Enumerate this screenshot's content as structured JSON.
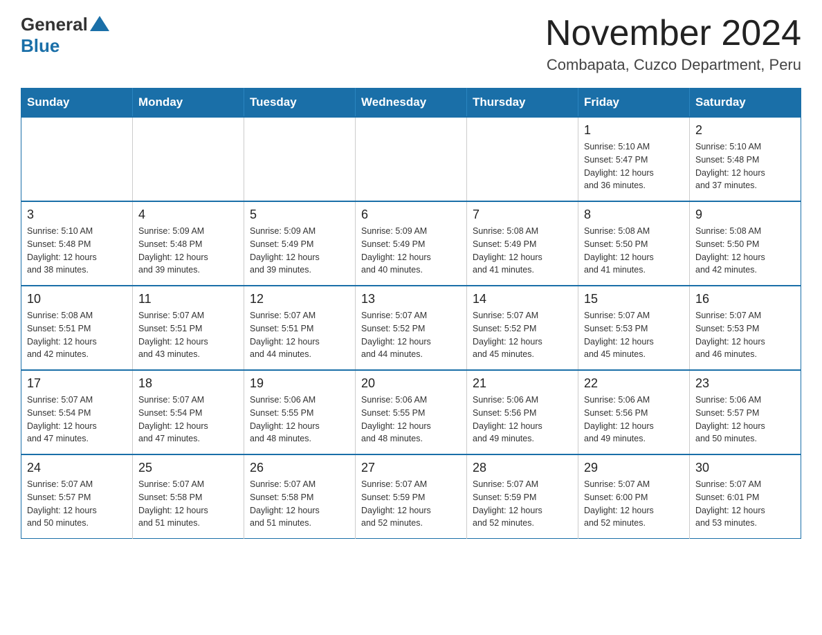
{
  "logo": {
    "text_general": "General",
    "text_blue": "Blue"
  },
  "title": "November 2024",
  "subtitle": "Combapata, Cuzco Department, Peru",
  "weekdays": [
    "Sunday",
    "Monday",
    "Tuesday",
    "Wednesday",
    "Thursday",
    "Friday",
    "Saturday"
  ],
  "weeks": [
    [
      {
        "day": "",
        "info": ""
      },
      {
        "day": "",
        "info": ""
      },
      {
        "day": "",
        "info": ""
      },
      {
        "day": "",
        "info": ""
      },
      {
        "day": "",
        "info": ""
      },
      {
        "day": "1",
        "info": "Sunrise: 5:10 AM\nSunset: 5:47 PM\nDaylight: 12 hours\nand 36 minutes."
      },
      {
        "day": "2",
        "info": "Sunrise: 5:10 AM\nSunset: 5:48 PM\nDaylight: 12 hours\nand 37 minutes."
      }
    ],
    [
      {
        "day": "3",
        "info": "Sunrise: 5:10 AM\nSunset: 5:48 PM\nDaylight: 12 hours\nand 38 minutes."
      },
      {
        "day": "4",
        "info": "Sunrise: 5:09 AM\nSunset: 5:48 PM\nDaylight: 12 hours\nand 39 minutes."
      },
      {
        "day": "5",
        "info": "Sunrise: 5:09 AM\nSunset: 5:49 PM\nDaylight: 12 hours\nand 39 minutes."
      },
      {
        "day": "6",
        "info": "Sunrise: 5:09 AM\nSunset: 5:49 PM\nDaylight: 12 hours\nand 40 minutes."
      },
      {
        "day": "7",
        "info": "Sunrise: 5:08 AM\nSunset: 5:49 PM\nDaylight: 12 hours\nand 41 minutes."
      },
      {
        "day": "8",
        "info": "Sunrise: 5:08 AM\nSunset: 5:50 PM\nDaylight: 12 hours\nand 41 minutes."
      },
      {
        "day": "9",
        "info": "Sunrise: 5:08 AM\nSunset: 5:50 PM\nDaylight: 12 hours\nand 42 minutes."
      }
    ],
    [
      {
        "day": "10",
        "info": "Sunrise: 5:08 AM\nSunset: 5:51 PM\nDaylight: 12 hours\nand 42 minutes."
      },
      {
        "day": "11",
        "info": "Sunrise: 5:07 AM\nSunset: 5:51 PM\nDaylight: 12 hours\nand 43 minutes."
      },
      {
        "day": "12",
        "info": "Sunrise: 5:07 AM\nSunset: 5:51 PM\nDaylight: 12 hours\nand 44 minutes."
      },
      {
        "day": "13",
        "info": "Sunrise: 5:07 AM\nSunset: 5:52 PM\nDaylight: 12 hours\nand 44 minutes."
      },
      {
        "day": "14",
        "info": "Sunrise: 5:07 AM\nSunset: 5:52 PM\nDaylight: 12 hours\nand 45 minutes."
      },
      {
        "day": "15",
        "info": "Sunrise: 5:07 AM\nSunset: 5:53 PM\nDaylight: 12 hours\nand 45 minutes."
      },
      {
        "day": "16",
        "info": "Sunrise: 5:07 AM\nSunset: 5:53 PM\nDaylight: 12 hours\nand 46 minutes."
      }
    ],
    [
      {
        "day": "17",
        "info": "Sunrise: 5:07 AM\nSunset: 5:54 PM\nDaylight: 12 hours\nand 47 minutes."
      },
      {
        "day": "18",
        "info": "Sunrise: 5:07 AM\nSunset: 5:54 PM\nDaylight: 12 hours\nand 47 minutes."
      },
      {
        "day": "19",
        "info": "Sunrise: 5:06 AM\nSunset: 5:55 PM\nDaylight: 12 hours\nand 48 minutes."
      },
      {
        "day": "20",
        "info": "Sunrise: 5:06 AM\nSunset: 5:55 PM\nDaylight: 12 hours\nand 48 minutes."
      },
      {
        "day": "21",
        "info": "Sunrise: 5:06 AM\nSunset: 5:56 PM\nDaylight: 12 hours\nand 49 minutes."
      },
      {
        "day": "22",
        "info": "Sunrise: 5:06 AM\nSunset: 5:56 PM\nDaylight: 12 hours\nand 49 minutes."
      },
      {
        "day": "23",
        "info": "Sunrise: 5:06 AM\nSunset: 5:57 PM\nDaylight: 12 hours\nand 50 minutes."
      }
    ],
    [
      {
        "day": "24",
        "info": "Sunrise: 5:07 AM\nSunset: 5:57 PM\nDaylight: 12 hours\nand 50 minutes."
      },
      {
        "day": "25",
        "info": "Sunrise: 5:07 AM\nSunset: 5:58 PM\nDaylight: 12 hours\nand 51 minutes."
      },
      {
        "day": "26",
        "info": "Sunrise: 5:07 AM\nSunset: 5:58 PM\nDaylight: 12 hours\nand 51 minutes."
      },
      {
        "day": "27",
        "info": "Sunrise: 5:07 AM\nSunset: 5:59 PM\nDaylight: 12 hours\nand 52 minutes."
      },
      {
        "day": "28",
        "info": "Sunrise: 5:07 AM\nSunset: 5:59 PM\nDaylight: 12 hours\nand 52 minutes."
      },
      {
        "day": "29",
        "info": "Sunrise: 5:07 AM\nSunset: 6:00 PM\nDaylight: 12 hours\nand 52 minutes."
      },
      {
        "day": "30",
        "info": "Sunrise: 5:07 AM\nSunset: 6:01 PM\nDaylight: 12 hours\nand 53 minutes."
      }
    ]
  ]
}
